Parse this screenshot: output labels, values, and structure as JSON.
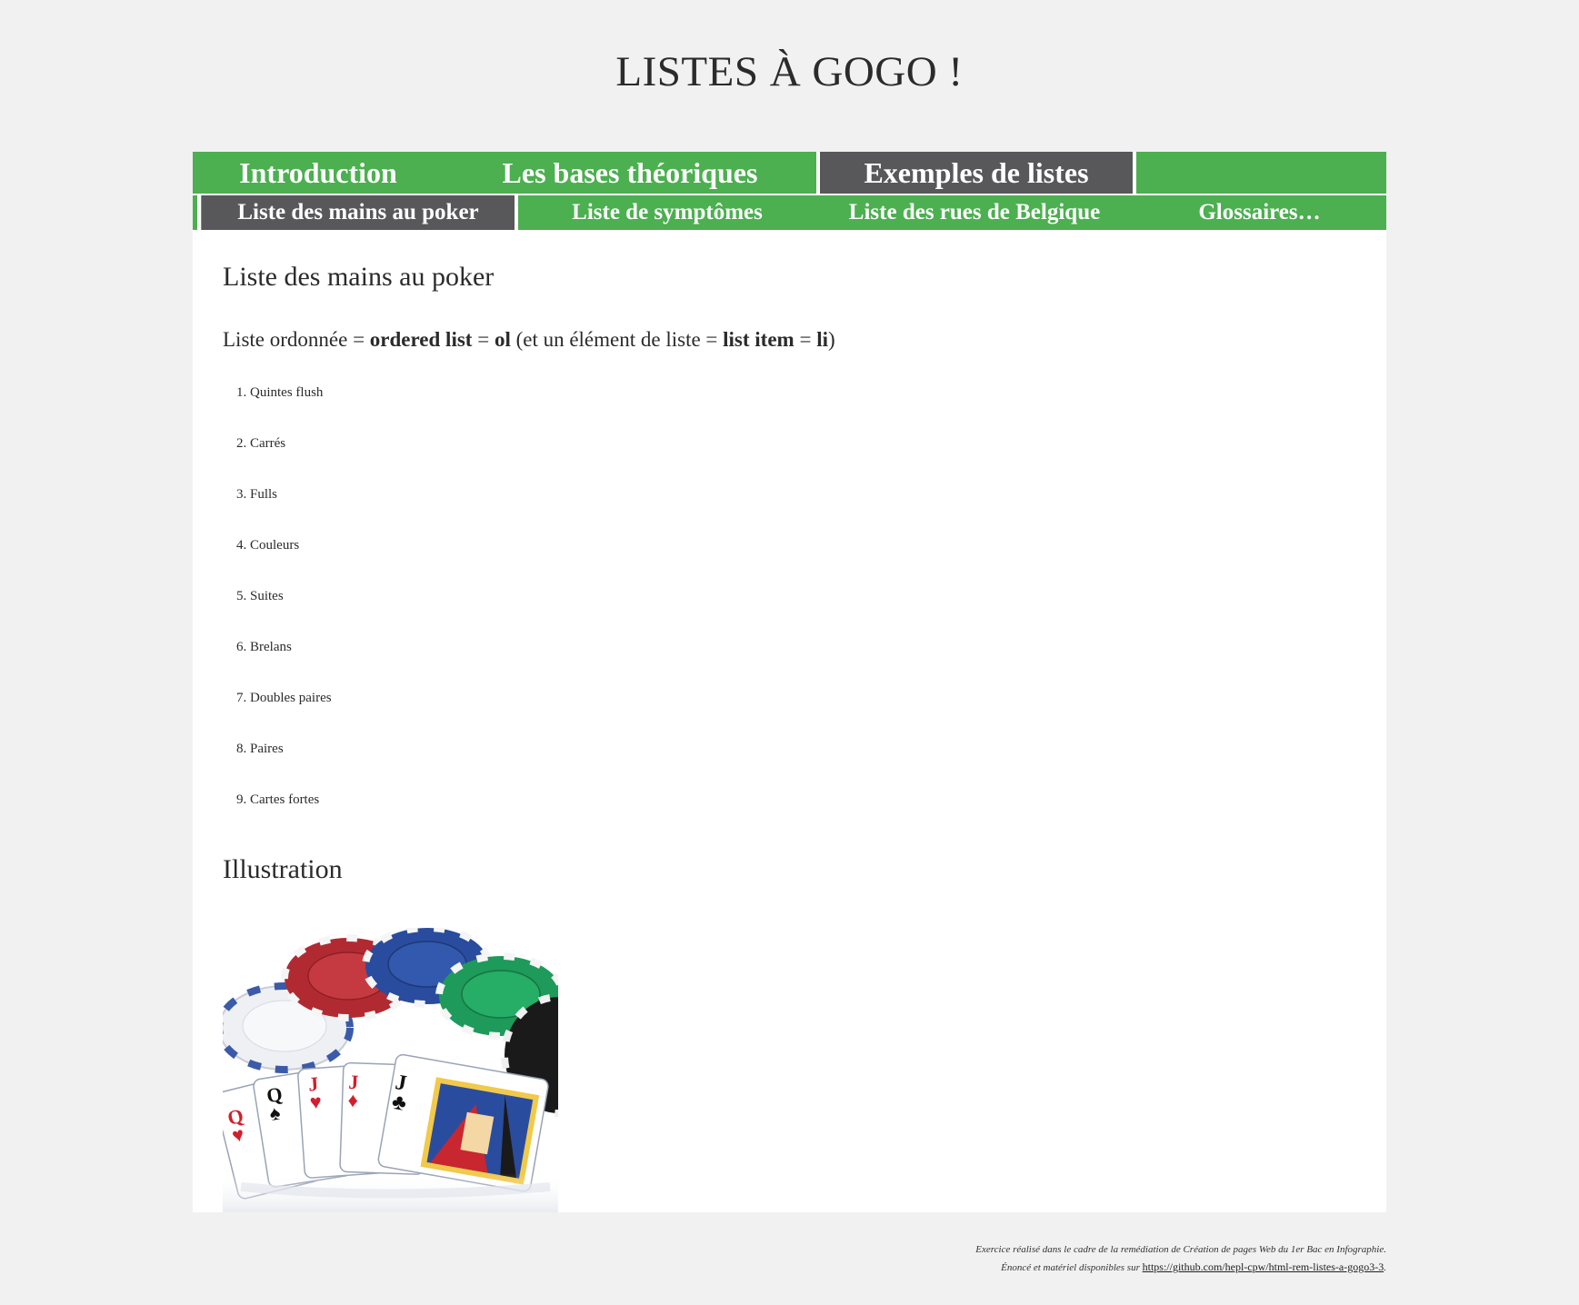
{
  "site": {
    "title": "LISTES À GOGO !"
  },
  "main_nav": {
    "items": [
      {
        "label": "Introduction"
      },
      {
        "label": "Les bases théoriques"
      },
      {
        "label": "Exemples de listes"
      }
    ],
    "active": "Exemples de listes"
  },
  "sub_nav": {
    "items": [
      {
        "label": "Liste des mains au poker"
      },
      {
        "label": "Liste de symptômes"
      },
      {
        "label": "Liste des rues de Belgique"
      },
      {
        "label": "Glossaires…"
      }
    ],
    "active": "Liste des mains au poker"
  },
  "content": {
    "title": "Liste des mains au poker",
    "intro": {
      "prefix": "Liste ordonnée = ",
      "term1": "ordered list",
      "eq1": " = ",
      "tag1": "ol",
      "middle": " (et un élément de liste = ",
      "term2": "list item",
      "eq2": " = ",
      "tag2": "li",
      "suffix": ")"
    },
    "list_items": [
      {
        "number": "1.",
        "label": "Quintes flush"
      },
      {
        "number": "2.",
        "label": "Carrés"
      },
      {
        "number": "3.",
        "label": "Fulls"
      },
      {
        "number": "4.",
        "label": "Couleurs"
      },
      {
        "number": "5.",
        "label": "Suites"
      },
      {
        "number": "6.",
        "label": "Brelans"
      },
      {
        "number": "7.",
        "label": "Doubles paires"
      },
      {
        "number": "8.",
        "label": "Paires"
      },
      {
        "number": "9.",
        "label": "Cartes fortes"
      }
    ],
    "illustration_title": "Illustration",
    "illustration": {
      "cards": [
        {
          "rank": "Q",
          "suit": "♥"
        },
        {
          "rank": "Q",
          "suit": "♠"
        },
        {
          "rank": "J",
          "suit": "♥"
        },
        {
          "rank": "J",
          "suit": "♦"
        },
        {
          "rank": "J",
          "suit": "♣"
        }
      ]
    }
  },
  "footer": {
    "line1": "Exercice réalisé dans le cadre de la remédiation de Création de pages Web du 1er Bac en Infographie.",
    "line2_prefix": "Énoncé et matériel disponibles sur ",
    "link": "https://github.com/hepl-cpw/html-rem-listes-a-gogo3-3",
    "line2_suffix": "."
  },
  "colors": {
    "page_bg": "#f1f1f1",
    "nav_green": "#4caf50",
    "nav_active": "#58585a",
    "content_bg": "#ffffff",
    "text": "#2b2b2b"
  }
}
